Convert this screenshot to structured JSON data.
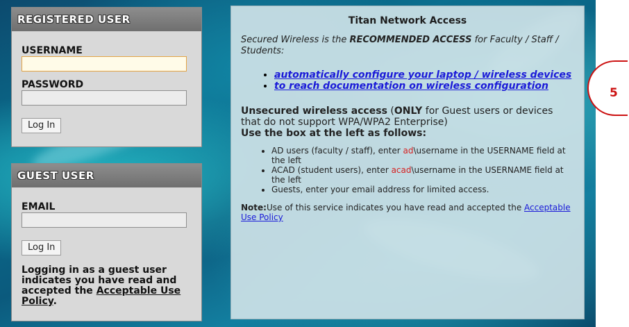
{
  "registered": {
    "header": "REGISTERED USER",
    "username_label": "USERNAME",
    "username_value": "",
    "password_label": "PASSWORD",
    "password_value": "",
    "login_label": "Log In"
  },
  "guest": {
    "header": "GUEST USER",
    "email_label": "EMAIL",
    "email_value": "",
    "login_label": "Log In",
    "note_text": "Logging in as a guest user indicates you have read and accepted the ",
    "note_link": "Acceptable Use Policy",
    "note_end": "."
  },
  "info": {
    "title": "Titan Network Access",
    "intro_a": "Secured Wireless is the ",
    "intro_b": "RECOMMENDED ACCESS",
    "intro_c": " for Faculty / Staff / Students:",
    "links": [
      "automatically configure your laptop / wireless devices",
      "to reach documentation on wireless configuration"
    ],
    "unsec_a": "Unsecured wireless access",
    "unsec_b": " (",
    "unsec_c": "ONLY",
    "unsec_d": " for Guest users or devices that do not support WPA/WPA2 Enterprise)",
    "use_box": "Use the box at the left as follows:",
    "bullets": {
      "ad_a": "AD users (faculty / staff), enter ",
      "ad_red": "ad",
      "ad_b": "\\username in the USERNAME field at the left",
      "acad_a": "ACAD (student users), enter ",
      "acad_red": "acad",
      "acad_b": "\\username in the USERNAME field at the left",
      "guests": "Guests, enter your email address for limited access."
    },
    "note_label": "Note:",
    "note_text": "Use of this service indicates you have read and accepted the ",
    "note_link": "Acceptable Use Policy"
  },
  "annotation": {
    "number": "5"
  },
  "colors": {
    "link": "#1a1ad8",
    "red": "#d62020",
    "badge": "#cc1111"
  }
}
